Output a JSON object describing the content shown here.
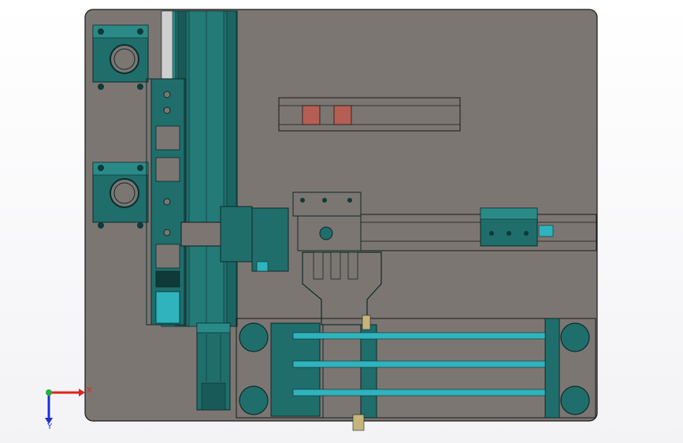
{
  "viewport": {
    "background": "#ffffff",
    "plate_color": "#7c7672",
    "teal_color": "#1f6e6c",
    "cyan_color": "#2fb3bd",
    "marker_color": "#b55e54"
  },
  "triad": {
    "x_label": "X",
    "y_label": "Y",
    "x_color": "#e0231b",
    "y_color": "#1c2fd6",
    "z_color": "#21b13a"
  }
}
